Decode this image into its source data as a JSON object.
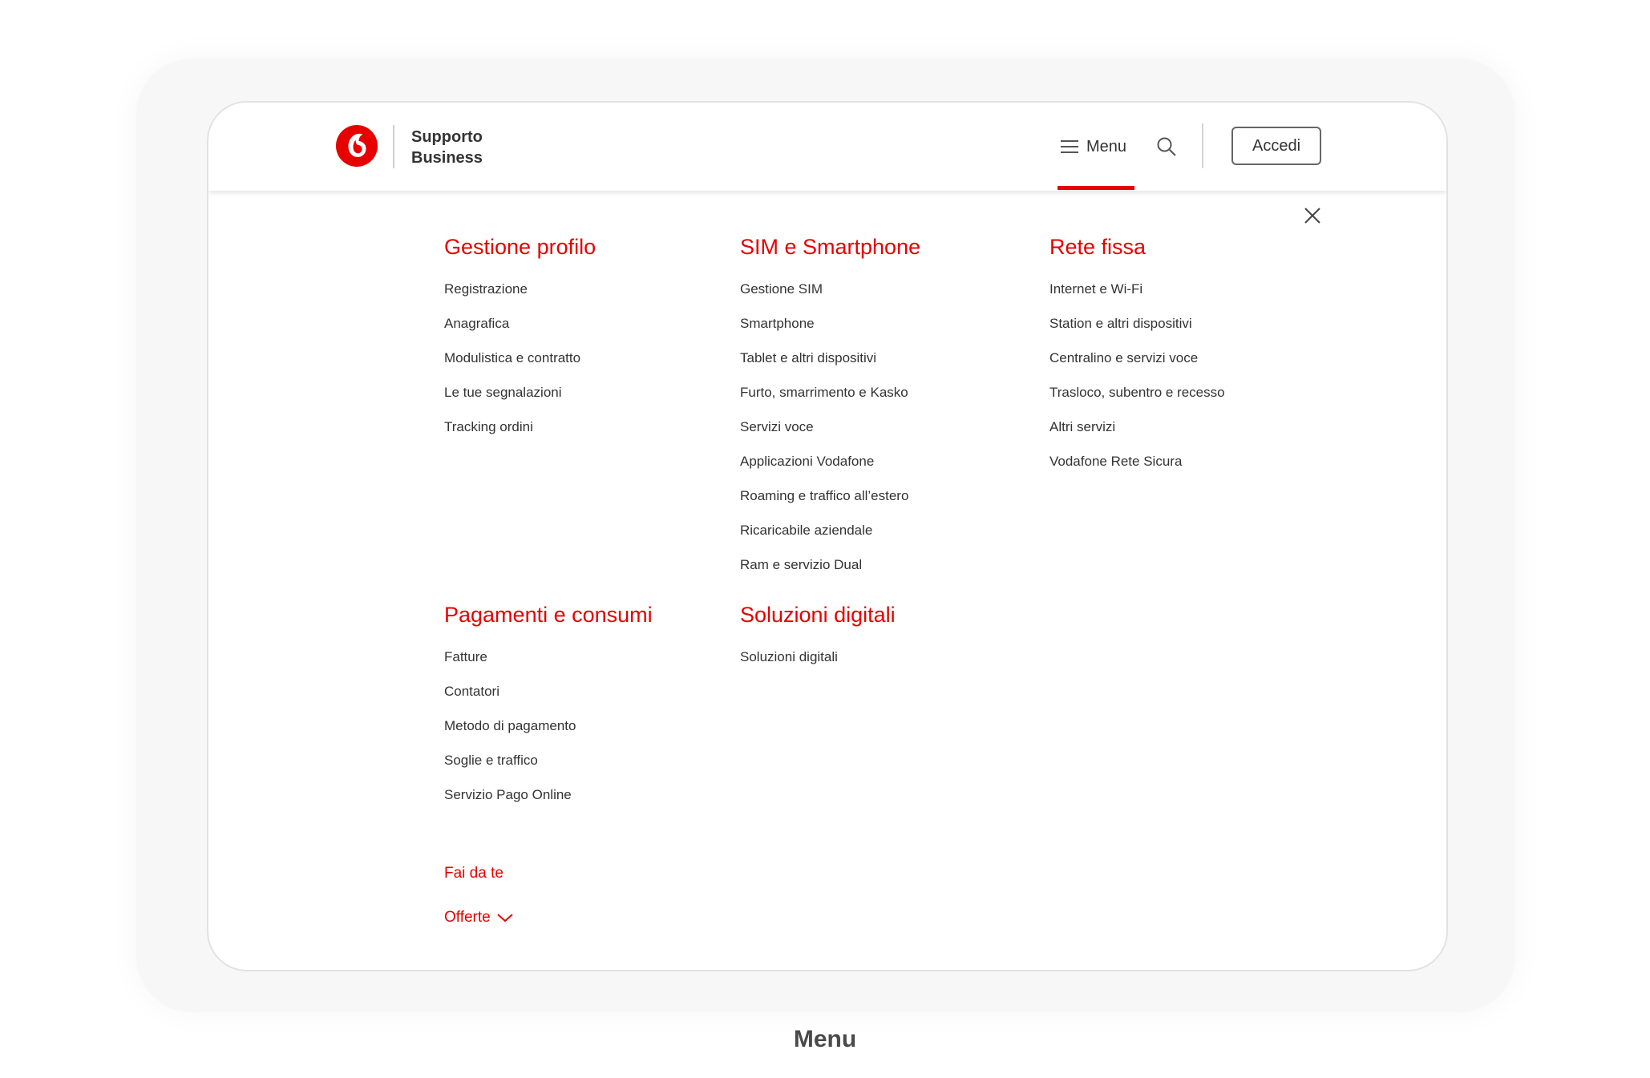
{
  "header": {
    "brand_line1": "Supporto",
    "brand_line2": "Business",
    "menu_label": "Menu",
    "login_label": "Accedi",
    "accent_color": "#e60000"
  },
  "menu": {
    "sections": [
      {
        "title": "Gestione profilo",
        "items": [
          "Registrazione",
          "Anagrafica",
          "Modulistica e contratto",
          "Le tue segnalazioni",
          "Tracking ordini"
        ]
      },
      {
        "title": "SIM e Smartphone",
        "items": [
          "Gestione SIM",
          "Smartphone",
          "Tablet e altri dispositivi",
          "Furto, smarrimento e Kasko",
          "Servizi voce",
          "Applicazioni Vodafone",
          "Roaming e traffico all’estero",
          "Ricaricabile aziendale",
          "Ram e servizio Dual"
        ]
      },
      {
        "title": "Rete fissa",
        "items": [
          "Internet e Wi-Fi",
          "Station e altri dispositivi",
          "Centralino e servizi voce",
          "Trasloco, subentro e recesso",
          "Altri servizi",
          "Vodafone Rete Sicura"
        ]
      },
      {
        "title": "Pagamenti e consumi",
        "items": [
          "Fatture",
          "Contatori",
          "Metodo di pagamento",
          "Soglie e traffico",
          "Servizio Pago Online"
        ]
      },
      {
        "title": "Soluzioni digitali",
        "items": [
          "Soluzioni digitali"
        ]
      }
    ],
    "fai_da_te": "Fai da te",
    "offerte": "Offerte"
  },
  "caption": "Menu",
  "icons": [
    "vodafone-logo",
    "hamburger-icon",
    "search-icon",
    "close-icon",
    "chevron-down-icon"
  ]
}
